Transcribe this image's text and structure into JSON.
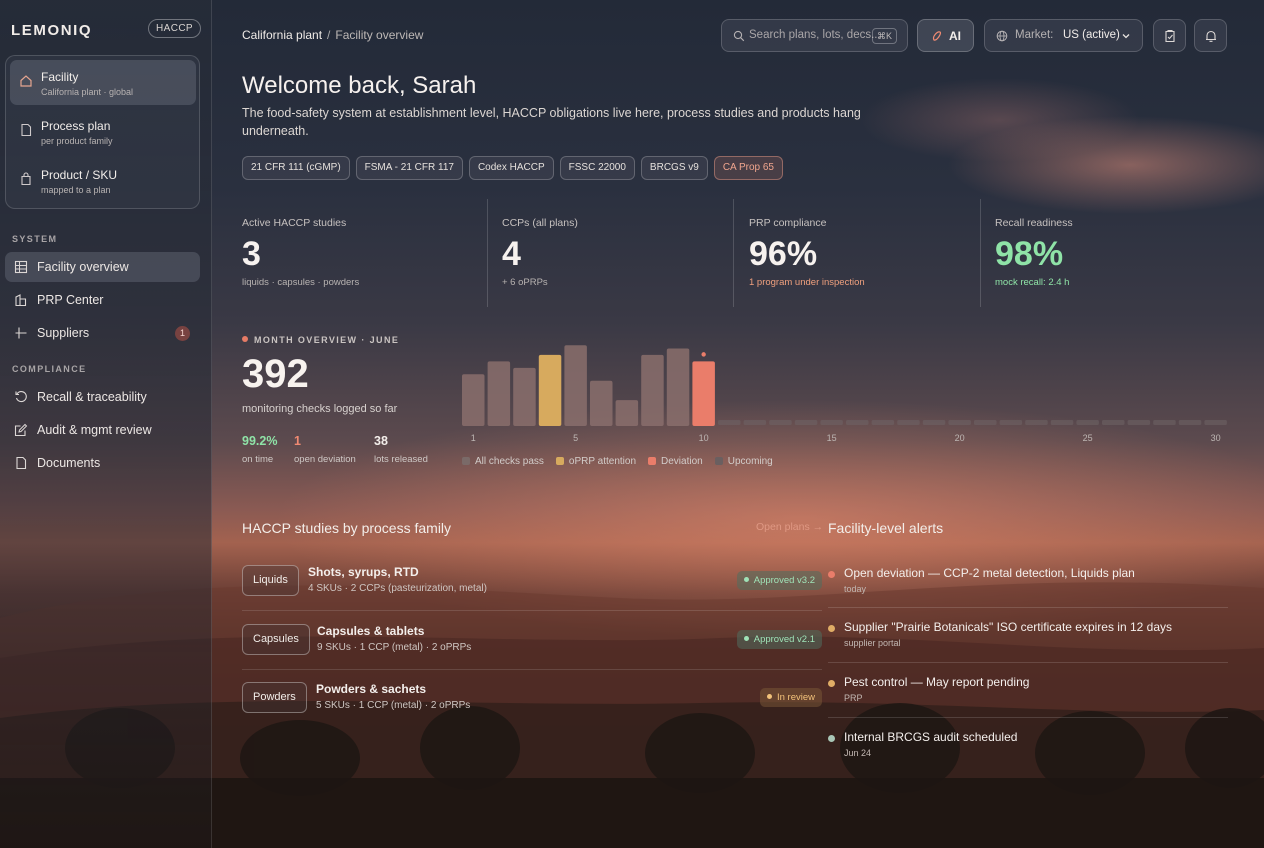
{
  "brand": {
    "name": "LEMONIQ",
    "badge": "HACCP"
  },
  "scope": [
    {
      "title": "Facility",
      "sub": "California plant · global",
      "icon": "home-icon",
      "active": true
    },
    {
      "title": "Process plan",
      "sub": "per product family",
      "icon": "document-icon",
      "active": false
    },
    {
      "title": "Product / SKU",
      "sub": "mapped to a plan",
      "icon": "bag-icon",
      "active": false
    }
  ],
  "sidebar": {
    "system_label": "SYSTEM",
    "system_items": [
      {
        "label": "Facility overview",
        "icon": "grid-icon",
        "active": true
      },
      {
        "label": "PRP Center",
        "icon": "building-icon",
        "active": false
      },
      {
        "label": "Suppliers",
        "icon": "hash-icon",
        "active": false,
        "badge": "1"
      }
    ],
    "compliance_label": "COMPLIANCE",
    "compliance_items": [
      {
        "label": "Recall & traceability",
        "icon": "refresh-icon"
      },
      {
        "label": "Audit & mgmt review",
        "icon": "edit-icon"
      },
      {
        "label": "Documents",
        "icon": "file-icon"
      }
    ]
  },
  "topbar": {
    "breadcrumb_root": "California plant",
    "breadcrumb_current": "Facility overview",
    "search_placeholder": "Search plans, lots, decs...",
    "search_shortcut": "⌘K",
    "ai_label": "AI",
    "market_label": "Market:",
    "market_value": "US (active)"
  },
  "hero": {
    "welcome": "Welcome back, Sarah",
    "intro": "The food-safety system at establishment level, HACCP obligations live here, process studies and products hang underneath.",
    "chips": [
      "21 CFR 111 (cGMP)",
      "FSMA - 21 CFR 117",
      "Codex HACCP",
      "FSSC 22000",
      "BRCGS v9",
      "CA Prop 65"
    ]
  },
  "kpis": [
    {
      "label": "Active HACCP studies",
      "value": "3",
      "sub": "liquids · capsules · powders",
      "value_color": "#f7f2ef",
      "sub_color": "#b8b3b1"
    },
    {
      "label": "CCPs (all plans)",
      "value": "4",
      "sub": "+ 6 oPRPs",
      "value_color": "#f7f2ef",
      "sub_color": "#b8b3b1"
    },
    {
      "label": "PRP compliance",
      "value": "96%",
      "sub": "1 program under inspection",
      "value_color": "#f7f2ef",
      "sub_color": "#f0a07e"
    },
    {
      "label": "Recall readiness",
      "value": "98%",
      "sub": "mock recall: 2.4 h",
      "value_color": "#8fe3a7",
      "sub_color": "#8fe3a7"
    }
  ],
  "month": {
    "label": "MONTH OVERVIEW · JUNE",
    "total": "392",
    "total_label": "monitoring checks logged so far",
    "stats": [
      {
        "value": "99.2%",
        "label": "on time",
        "color": "#8fe3a7"
      },
      {
        "value": "1",
        "label": "open deviation",
        "color": "#f08a72"
      },
      {
        "value": "38",
        "label": "lots released",
        "color": "#f3eeea"
      }
    ],
    "legend": [
      {
        "label": "All checks pass",
        "color": "#7a6a68"
      },
      {
        "label": "oPRP attention",
        "color": "#d7aa5e"
      },
      {
        "label": "Deviation",
        "color": "#ea7d6a"
      },
      {
        "label": "Upcoming",
        "color": "#6a5f60"
      }
    ]
  },
  "chart_data": {
    "type": "bar",
    "title": "MONTH OVERVIEW · JUNE",
    "x_ticks": [
      "1",
      "5",
      "10",
      "15",
      "20",
      "25",
      "30"
    ],
    "categories": [
      "1",
      "2",
      "3",
      "4",
      "5",
      "6",
      "7",
      "8",
      "9",
      "10",
      "11",
      "12",
      "13",
      "14",
      "15",
      "16",
      "17",
      "18",
      "19",
      "20",
      "21",
      "22",
      "23",
      "24",
      "25",
      "26",
      "27",
      "28",
      "29",
      "30"
    ],
    "values": [
      16,
      20,
      18,
      22,
      25,
      14,
      8,
      22,
      24,
      20,
      0,
      0,
      0,
      0,
      0,
      0,
      0,
      0,
      0,
      0,
      0,
      0,
      0,
      0,
      0,
      0,
      0,
      0,
      0,
      0
    ],
    "status": [
      "pass",
      "pass",
      "pass",
      "attention",
      "pass",
      "pass",
      "pass",
      "pass",
      "pass",
      "deviation",
      "upcoming",
      "upcoming",
      "upcoming",
      "upcoming",
      "upcoming",
      "upcoming",
      "upcoming",
      "upcoming",
      "upcoming",
      "upcoming",
      "upcoming",
      "upcoming",
      "upcoming",
      "upcoming",
      "upcoming",
      "upcoming",
      "upcoming",
      "upcoming",
      "upcoming",
      "upcoming"
    ],
    "ylim": [
      0,
      26
    ],
    "legend": [
      "All checks pass",
      "oPRP attention",
      "Deviation",
      "Upcoming"
    ],
    "legend_position": "bottom-left",
    "grid": false
  },
  "studies": {
    "title": "HACCP studies by process family",
    "link": "Open plans →",
    "items": [
      {
        "family": "Liquids",
        "title": "Shots, syrups, RTD",
        "sub": "4 SKUs · 2 CCPs (pasteurization, metal)",
        "status": "Approved v3.2",
        "kind": "ok"
      },
      {
        "family": "Capsules",
        "title": "Capsules & tablets",
        "sub": "9 SKUs · 1 CCP (metal) · 2 oPRPs",
        "status": "Approved v2.1",
        "kind": "ok"
      },
      {
        "family": "Powders",
        "title": "Powders & sachets",
        "sub": "5 SKUs · 1 CCP (metal) · 2 oPRPs",
        "status": "In review",
        "kind": "rev"
      }
    ]
  },
  "alerts": {
    "title": "Facility-level alerts",
    "items": [
      {
        "title": "Open deviation — CCP-2 metal detection, Liquids plan",
        "sub": "today",
        "color": "#ea7d6a"
      },
      {
        "title": "Supplier \"Prairie Botanicals\" ISO certificate expires in 12 days",
        "sub": "supplier portal",
        "color": "#e0ad66"
      },
      {
        "title": "Pest control — May report pending",
        "sub": "PRP",
        "color": "#e0ad66"
      },
      {
        "title": "Internal BRCGS audit scheduled",
        "sub": "Jun 24",
        "color": "#a9c6b6"
      }
    ]
  }
}
